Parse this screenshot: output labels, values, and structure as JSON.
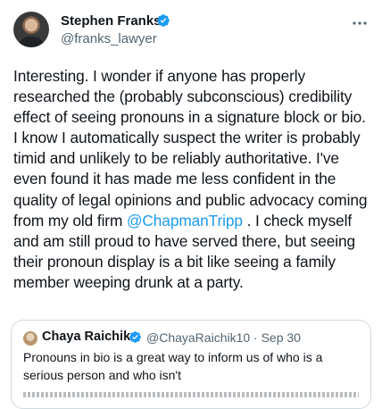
{
  "author": {
    "display_name": "Stephen Franks",
    "handle": "@franks_lawyer",
    "verified": true
  },
  "tweet": {
    "lines": [
      "Interesting. I wonder if anyone has properly",
      "researched the (probably subconscious) credibility",
      "effect of seeing pronouns in a signature block or bio.",
      "I know I automatically suspect the writer is probably",
      "timid and unlikely to be reliably authoritative. I've",
      "even found it has made me less confident in the",
      "quality of legal opinions and public advocacy coming"
    ],
    "line8_before": "from my old firm ",
    "mention": "@ChapmanTripp",
    "line8_after": " .   I check myself",
    "lines_end": [
      "and am still proud to have served there, but seeing",
      "their pronoun display is a bit like seeing a family",
      "member weeping drunk at a party."
    ]
  },
  "quoted": {
    "display_name": "Chaya Raichik",
    "verified": true,
    "meta": "@ChayaRaichik10 · Sep 30",
    "lines": [
      "Pronouns in bio is a great way to inform us of who is a",
      "serious person and who isn't"
    ]
  },
  "icons": {
    "verified": "verified-badge-icon",
    "more": "more-options-icon"
  },
  "colors": {
    "verified": "#1d9bf0",
    "mention": "#1d9bf0",
    "secondary_text": "#536471",
    "border": "#cfd9de"
  }
}
